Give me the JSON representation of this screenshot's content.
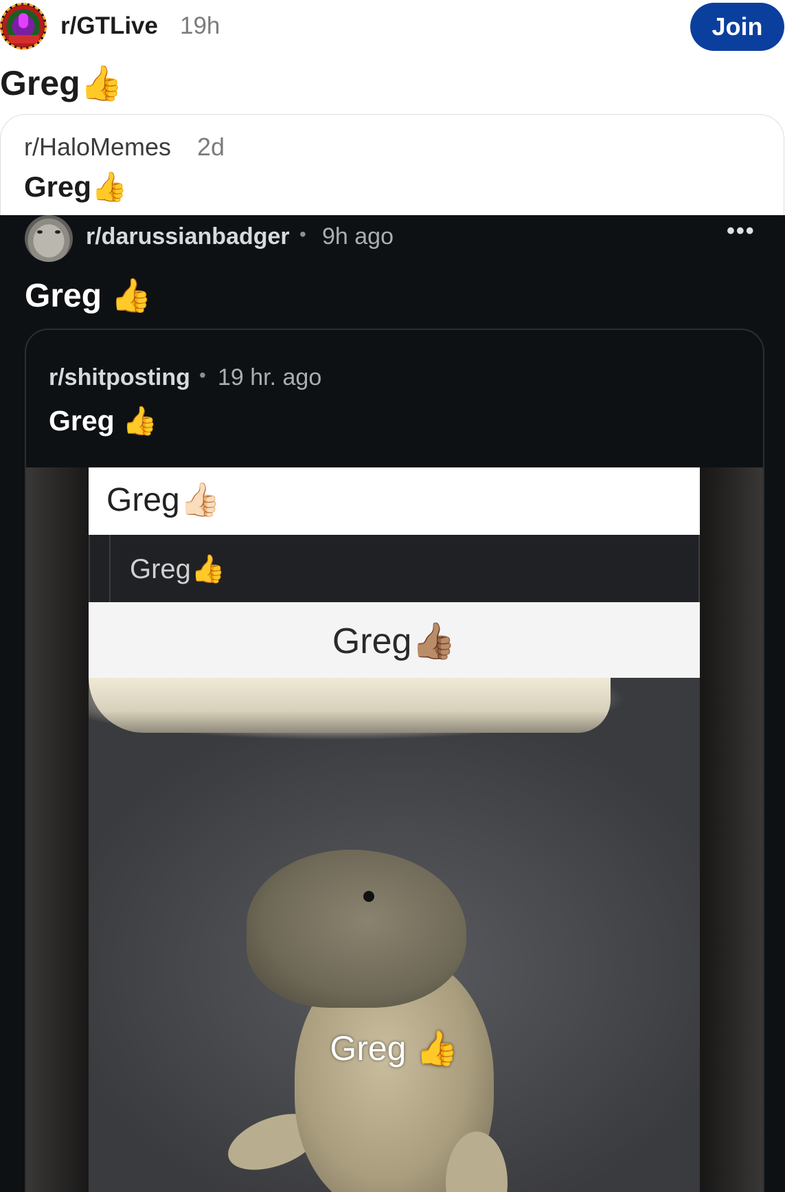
{
  "header": {
    "subreddit": "r/GTLive",
    "age": "19h",
    "join_label": "Join"
  },
  "post": {
    "title": "Greg",
    "emoji": "👍"
  },
  "crosspost": {
    "subreddit": "r/HaloMemes",
    "age": "2d",
    "title": "Greg",
    "emoji": "👍"
  },
  "dark_post": {
    "subreddit": "r/darussianbadger",
    "separator": "•",
    "age": "9h ago",
    "more": "•••",
    "title": "Greg",
    "emoji": "👍"
  },
  "dark_crosspost": {
    "subreddit": "r/shitposting",
    "separator": "•",
    "age": "19 hr. ago",
    "title": "Greg",
    "emoji": "👍"
  },
  "meme": {
    "line1": "Greg",
    "line1_emoji": "👍🏻",
    "line2": "Greg",
    "line2_emoji": "👍",
    "line3": "Greg",
    "line3_emoji": "👍🏽",
    "caption": "Greg",
    "caption_emoji": "👍"
  },
  "colors": {
    "join_button": "#0b3f9e",
    "dark_bg": "#0e1114"
  }
}
